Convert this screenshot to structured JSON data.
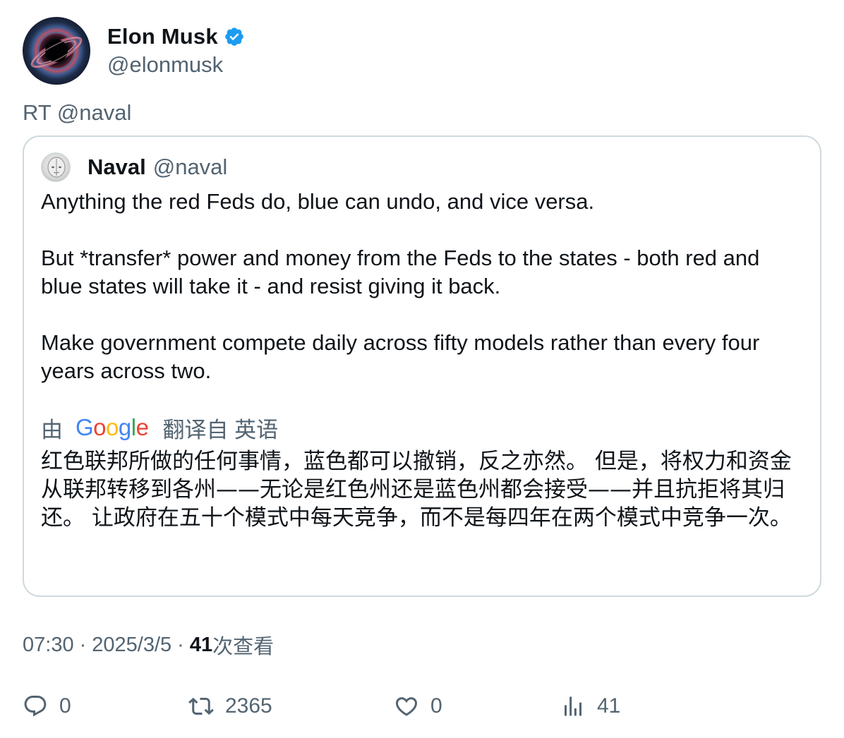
{
  "author": {
    "display_name": "Elon Musk",
    "handle": "@elonmusk",
    "verified": true,
    "avatar_icon": "black-hole-avatar"
  },
  "rt_text": "RT @naval",
  "quote": {
    "display_name": "Naval",
    "handle": "@naval",
    "avatar_icon": "naval-avatar",
    "paragraphs": [
      "Anything the red Feds do, blue can undo, and vice versa.",
      "But *transfer* power and money from the Feds to the states - both red and blue states will take it - and resist giving it back.",
      "Make government compete daily across fifty models rather than every four years across two."
    ],
    "translate": {
      "prefix": "由",
      "brand": "Google",
      "suffix": "翻译自 英语"
    },
    "translated_text": "红色联邦所做的任何事情，蓝色都可以撤销，反之亦然。 但是，将权力和资金从联邦转移到各州——无论是红色州还是蓝色州都会接受——并且抗拒将其归还。 让政府在五十个模式中每天竞争，而不是每四年在两个模式中竞争一次。"
  },
  "meta": {
    "time": "07:30",
    "date": "2025/3/5",
    "views_count": "41",
    "views_label": "次查看"
  },
  "actions": {
    "reply_count": "0",
    "retweet_count": "2365",
    "like_count": "0",
    "views_count": "41"
  },
  "colors": {
    "text_primary": "#0f1419",
    "text_secondary": "#536471",
    "border": "#cfd9de",
    "verified_blue": "#1d9bf0"
  }
}
